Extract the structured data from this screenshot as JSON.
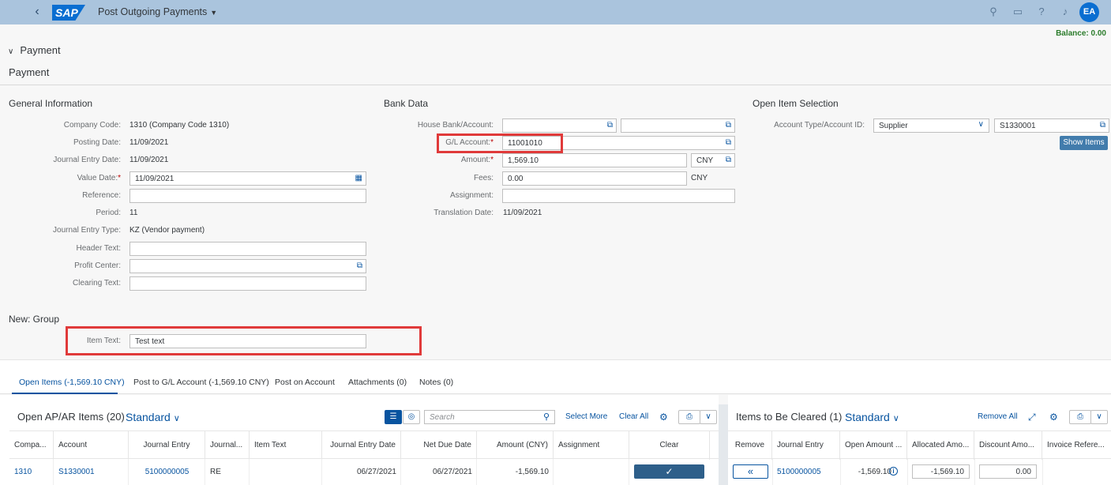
{
  "shell": {
    "logo": "SAP",
    "title": "Post Outgoing Payments",
    "avatar": "EA",
    "icons": [
      "search-icon",
      "chat-icon",
      "help-icon",
      "bell-icon"
    ]
  },
  "balance": "Balance: 0.00",
  "section": {
    "toggle_label": "Payment",
    "title": "Payment"
  },
  "general": {
    "title": "General Information",
    "company_code_label": "Company Code:",
    "company_code": "1310 (Company Code 1310)",
    "posting_date_label": "Posting Date:",
    "posting_date": "11/09/2021",
    "je_date_label": "Journal Entry Date:",
    "je_date": "11/09/2021",
    "value_date_label": "Value Date:",
    "value_date": "11/09/2021",
    "reference_label": "Reference:",
    "reference": "",
    "period_label": "Period:",
    "period": "11",
    "je_type_label": "Journal Entry Type:",
    "je_type": "KZ (Vendor payment)",
    "header_text_label": "Header Text:",
    "header_text": "",
    "profit_center_label": "Profit Center:",
    "profit_center": "",
    "clearing_text_label": "Clearing Text:",
    "clearing_text": ""
  },
  "new_group": {
    "title": "New: Group",
    "item_text_label": "Item Text:",
    "item_text": "Test text"
  },
  "bank": {
    "title": "Bank Data",
    "house_bank_label": "House Bank/Account:",
    "house_bank": "",
    "house_account": "",
    "gl_account_label": "G/L Account:",
    "gl_account": "11001010",
    "amount_label": "Amount:",
    "amount": "1,569.10",
    "currency": "CNY",
    "fees_label": "Fees:",
    "fees": "0.00",
    "fees_currency": "CNY",
    "assignment_label": "Assignment:",
    "assignment": "",
    "translation_date_label": "Translation Date:",
    "translation_date": "11/09/2021"
  },
  "open_item_selection": {
    "title": "Open Item Selection",
    "account_type_label": "Account Type/Account ID:",
    "account_type": "Supplier",
    "account_id": "S1330001",
    "show_items": "Show Items"
  },
  "tabs": [
    "Open Items (-1,569.10 CNY)",
    "Post to G/L Account (-1,569.10 CNY)",
    "Post on Account",
    "Attachments (0)",
    "Notes (0)"
  ],
  "open_items": {
    "title": "Open AP/AR Items (20)",
    "variant": "Standard",
    "search_placeholder": "Search",
    "select_more": "Select More",
    "clear_all": "Clear All",
    "columns": [
      "Compa...",
      "Account",
      "Journal Entry",
      "Journal...",
      "Item Text",
      "Journal Entry Date",
      "Net Due Date",
      "Amount (CNY)",
      "Assignment",
      "Clear"
    ],
    "row": [
      "1310",
      "S1330001",
      "5100000005",
      "RE",
      "",
      "06/27/2021",
      "06/27/2021",
      "-1,569.10",
      "",
      ""
    ]
  },
  "to_be_cleared": {
    "title": "Items to Be Cleared (1)",
    "variant": "Standard",
    "remove_all": "Remove All",
    "columns": [
      "Remove",
      "Journal Entry",
      "Open Amount ...",
      "Allocated Amo...",
      "Discount Amo...",
      "Invoice Refere..."
    ],
    "row": {
      "journal_entry": "5100000005",
      "open_amount": "-1,569.10",
      "allocated": "-1,569.10",
      "discount": "0.00"
    }
  }
}
